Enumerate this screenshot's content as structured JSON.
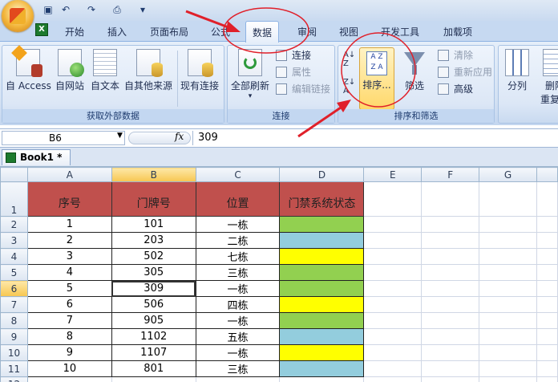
{
  "tabs": [
    "开始",
    "插入",
    "页面布局",
    "公式",
    "数据",
    "审阅",
    "视图",
    "开发工具",
    "加载项"
  ],
  "active_tab": "数据",
  "ribbon": {
    "get_data": {
      "label": "获取外部数据",
      "buttons": [
        "自 Access",
        "自网站",
        "自文本",
        "自其他来源",
        "现有连接"
      ]
    },
    "connections": {
      "label": "连接",
      "refresh": "全部刷新",
      "small": [
        "连接",
        "属性",
        "编辑链接"
      ]
    },
    "sort_filter": {
      "label": "排序和筛选",
      "sort": "排序...",
      "filter": "筛选",
      "small": [
        "清除",
        "重新应用",
        "高级"
      ]
    },
    "data_tools": {
      "buttons": [
        "分列",
        "删除",
        "重复项"
      ]
    }
  },
  "formula": {
    "namebox": "B6",
    "fx": "fx",
    "value": "309"
  },
  "workbook_tab": "Book1 *",
  "columns": [
    "A",
    "B",
    "C",
    "D",
    "E",
    "F",
    "G"
  ],
  "rows": [
    "1",
    "2",
    "3",
    "4",
    "5",
    "6",
    "7",
    "8",
    "9",
    "10",
    "11",
    "12"
  ],
  "table": {
    "headers": [
      "序号",
      "门牌号",
      "位置",
      "门禁系统状态"
    ],
    "data": [
      [
        "1",
        "101",
        "一栋",
        "#92d050"
      ],
      [
        "2",
        "203",
        "二栋",
        "#93cddd"
      ],
      [
        "3",
        "502",
        "七栋",
        "#ffff00"
      ],
      [
        "4",
        "305",
        "三栋",
        "#92d050"
      ],
      [
        "5",
        "309",
        "一栋",
        "#92d050"
      ],
      [
        "6",
        "506",
        "四栋",
        "#ffff00"
      ],
      [
        "7",
        "905",
        "一栋",
        "#92d050"
      ],
      [
        "8",
        "1102",
        "五栋",
        "#93cddd"
      ],
      [
        "9",
        "1107",
        "一栋",
        "#ffff00"
      ],
      [
        "10",
        "801",
        "三栋",
        "#93cddd"
      ]
    ]
  },
  "colors": {
    "header_fill": "#c0504d",
    "annotation": "#e0202a"
  }
}
